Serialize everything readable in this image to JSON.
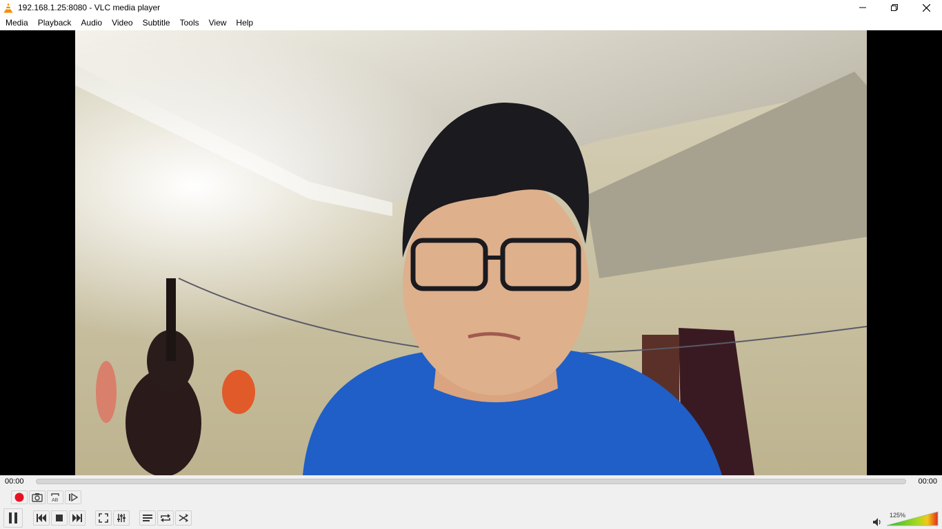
{
  "window": {
    "title": "192.168.1.25:8080 - VLC media player",
    "app_icon": "vlc-cone-icon"
  },
  "menu": [
    "Media",
    "Playback",
    "Audio",
    "Video",
    "Subtitle",
    "Tools",
    "View",
    "Help"
  ],
  "playback": {
    "elapsed": "00:00",
    "total": "00:00",
    "progress": 0
  },
  "volume": {
    "label": "125%",
    "level": 1.25
  },
  "colors": {
    "record": "#e81123",
    "volume_low": "#2bbf2b",
    "volume_high": "#e0311a"
  }
}
